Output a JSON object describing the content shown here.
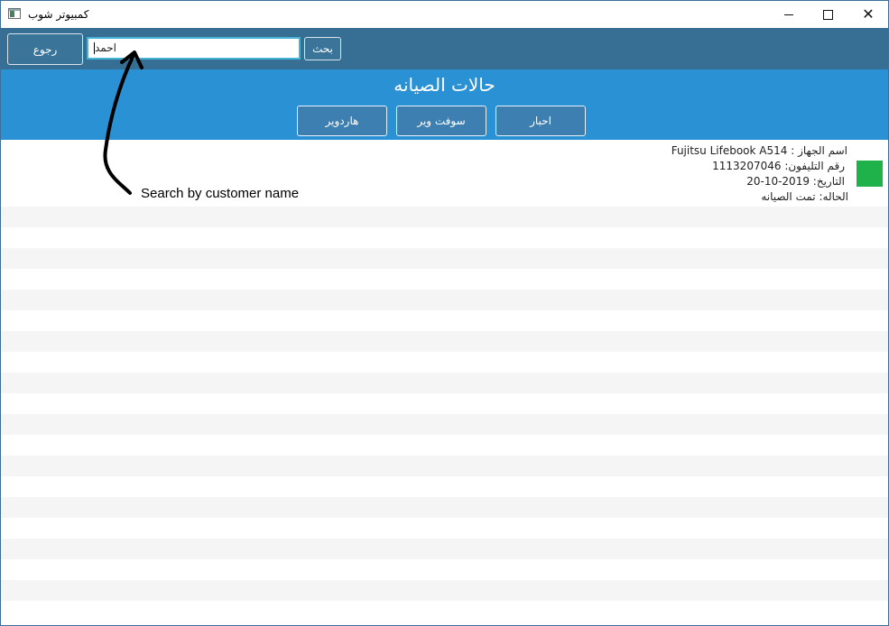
{
  "window": {
    "title": "كمبيوتر شوب",
    "controls": {
      "minimize": "minimize",
      "maximize": "maximize",
      "close": "✕"
    }
  },
  "toolbar": {
    "back_label": "رجوع",
    "search_value": "احمد",
    "search_label": "بحث"
  },
  "header": {
    "title": "حالات الصيانه",
    "filters": [
      "احبار",
      "سوفت وير",
      "هاردوير"
    ]
  },
  "records": [
    {
      "device_label": "اسم الجهاز :",
      "device_value": "Fujitsu Lifebook A514",
      "phone_label": "رقم التليفون:",
      "phone_value": "1113207046",
      "date_label": "التاريخ:",
      "date_value": "20-10-2019",
      "status_label": "الحاله:",
      "status_value": "تمت الصيانه",
      "status_color": "#1fb24a"
    }
  ],
  "annotation": {
    "text": "Search by customer name"
  },
  "colors": {
    "toolbar": "#366f93",
    "header": "#2a91d4",
    "input_border": "#45b3d6",
    "stripe": "#f5f5f5"
  }
}
